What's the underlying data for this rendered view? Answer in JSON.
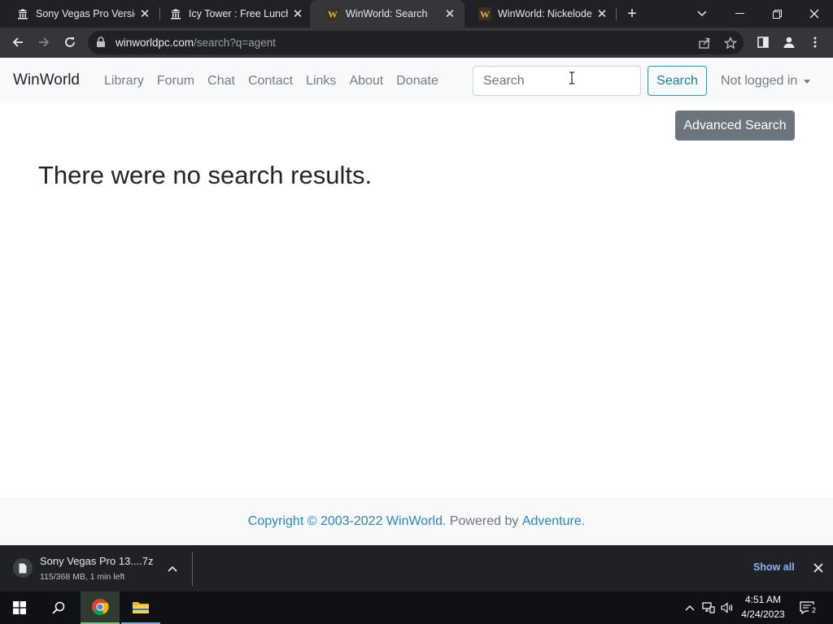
{
  "browser": {
    "tabs": [
      {
        "title": "Sony Vegas Pro Version",
        "favicon": "museum-icon",
        "active": false
      },
      {
        "title": "Icy Tower : Free Lunch",
        "favicon": "museum-icon",
        "active": false
      },
      {
        "title": "WinWorld: Search",
        "favicon": "winworld-icon",
        "active": true
      },
      {
        "title": "WinWorld: Nickelodeon",
        "favicon": "winworld-icon",
        "active": false
      }
    ],
    "url_host": "winworldpc.com",
    "url_path": "/search?q=agent"
  },
  "page": {
    "brand": "WinWorld",
    "nav": [
      "Library",
      "Forum",
      "Chat",
      "Contact",
      "Links",
      "About",
      "Donate"
    ],
    "search": {
      "placeholder": "Search",
      "value": "",
      "button": "Search"
    },
    "user_menu": "Not logged in",
    "advanced_search": "Advanced Search",
    "message": "There were no search results.",
    "footer": {
      "copyright": "Copyright © 2003-2022",
      "site_link": "WinWorld",
      "powered_by": ". Powered by",
      "engine_link": "Adventure",
      "end": "."
    },
    "colors": {
      "link": "#2a84c4",
      "search_button": "#17a2b8",
      "advanced_button": "#6c757d"
    }
  },
  "download": {
    "filename": "Sony Vegas Pro 13....7z",
    "status": "115/368 MB, 1 min left",
    "show_all": "Show all"
  },
  "taskbar": {
    "time": "4:51 AM",
    "date": "4/24/2023",
    "notifications": "2"
  }
}
